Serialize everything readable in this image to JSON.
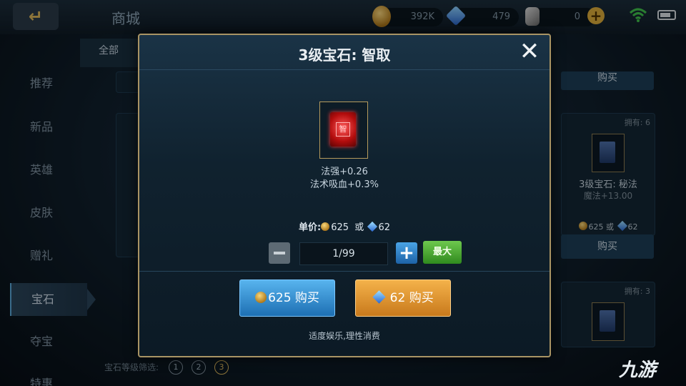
{
  "topbar": {
    "back_label": "↵",
    "title": "商城",
    "gold": "392K",
    "diamonds": "479",
    "stones": "0"
  },
  "sidebar": {
    "items": [
      {
        "label": "推荐"
      },
      {
        "label": "新品"
      },
      {
        "label": "英雄"
      },
      {
        "label": "皮肤"
      },
      {
        "label": "赠礼"
      },
      {
        "label": "宝石",
        "active": true
      },
      {
        "label": "夺宝"
      },
      {
        "label": "特惠"
      }
    ]
  },
  "subtabs": {
    "all": "全部"
  },
  "background_cards": {
    "top_buy_label": "购买",
    "card1": {
      "stock": "拥有: 6",
      "name": "3级宝石: 秘法",
      "stat": "魔法+13.00",
      "price_gold": "625",
      "or": "或",
      "price_diamond": "62",
      "buy_label": "购买"
    },
    "card2": {
      "stock": "拥有: 3"
    }
  },
  "filter": {
    "label": "宝石等级筛选:",
    "levels": [
      "1",
      "2",
      "3"
    ],
    "selected": "3"
  },
  "watermark": "九游",
  "modal": {
    "title": "3级宝石: 智取",
    "close": "✕",
    "gem_glyph": "智",
    "stats": [
      "法强+0.26",
      "法术吸血+0.3%"
    ],
    "unit_price_label": "单价:",
    "price_gold": "625",
    "or": "或",
    "price_diamond": "62",
    "quantity": "1/99",
    "max_label": "最大",
    "plus": "+",
    "buy_gold_label": "625 购买",
    "buy_diamond_label": "62 购买",
    "notice": "适度娱乐,理性消费"
  },
  "colors": {
    "accent_gold": "#d9b45a",
    "buy_blue": "#1d6fb3",
    "buy_orange": "#c8791c",
    "max_green": "#2f8a1e",
    "frame_gold": "#a99464"
  }
}
